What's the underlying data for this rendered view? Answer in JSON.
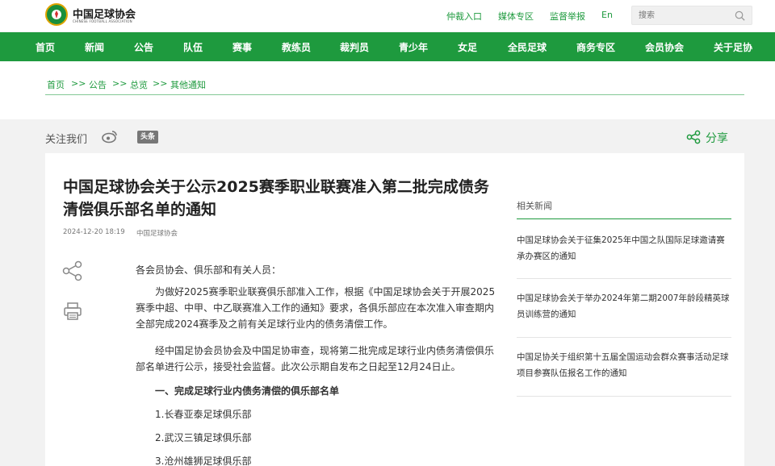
{
  "header": {
    "logo_title": "中国足球协会",
    "logo_subtitle": "CHINESE FOOTBALL ASSOCIATION",
    "links": [
      "仲裁入口",
      "媒体专区",
      "监督举报",
      "En"
    ],
    "search_placeholder": "搜索"
  },
  "nav": {
    "items": [
      "首页",
      "新闻",
      "公告",
      "队伍",
      "赛事",
      "教练员",
      "裁判员",
      "青少年",
      "女足",
      "全民足球",
      "商务专区",
      "会员协会",
      "关于足协"
    ]
  },
  "breadcrumb": {
    "items": [
      "首页",
      "公告",
      "总览",
      "其他通知"
    ],
    "separator": ">>"
  },
  "social": {
    "follow_label": "关注我们",
    "toutiao_label": "头条",
    "share_label": "分享"
  },
  "article": {
    "title": "中国足球协会关于公示2025赛季职业联赛准入第二批完成债务清偿俱乐部名单的通知",
    "date": "2024-12-20 18:19",
    "source": "中国足球协会",
    "paragraphs": [
      "各会员协会、俱乐部和有关人员：",
      "为做好2025赛季职业联赛俱乐部准入工作，根据《中国足球协会关于开展2025赛季中超、中甲、中乙联赛准入工作的通知》要求，各俱乐部应在本次准入审查期内全部完成2024赛季及之前有关足球行业内的债务清偿工作。",
      "经中国足协会员协会及中国足协审查，现将第二批完成足球行业内债务清偿俱乐部名单进行公示，接受社会监督。此次公示期自发布之日起至12月24日止。",
      "一、完成足球行业内债务清偿的俱乐部名单",
      "1.长春亚泰足球俱乐部",
      "2.武汉三镇足球俱乐部",
      "3.沧州雄狮足球俱乐部"
    ]
  },
  "related": {
    "heading": "相关新闻",
    "items": [
      "中国足球协会关于征集2025年中国之队国际足球邀请赛承办赛区的通知",
      "中国足球协会关于举办2024年第二期2007年龄段精英球员训练营的通知",
      "中国足协关于组织第十五届全国运动会群众赛事活动足球项目参赛队伍报名工作的通知"
    ]
  },
  "colors": {
    "brand_green": "#1e9a3e",
    "background": "#f2f2f2"
  }
}
